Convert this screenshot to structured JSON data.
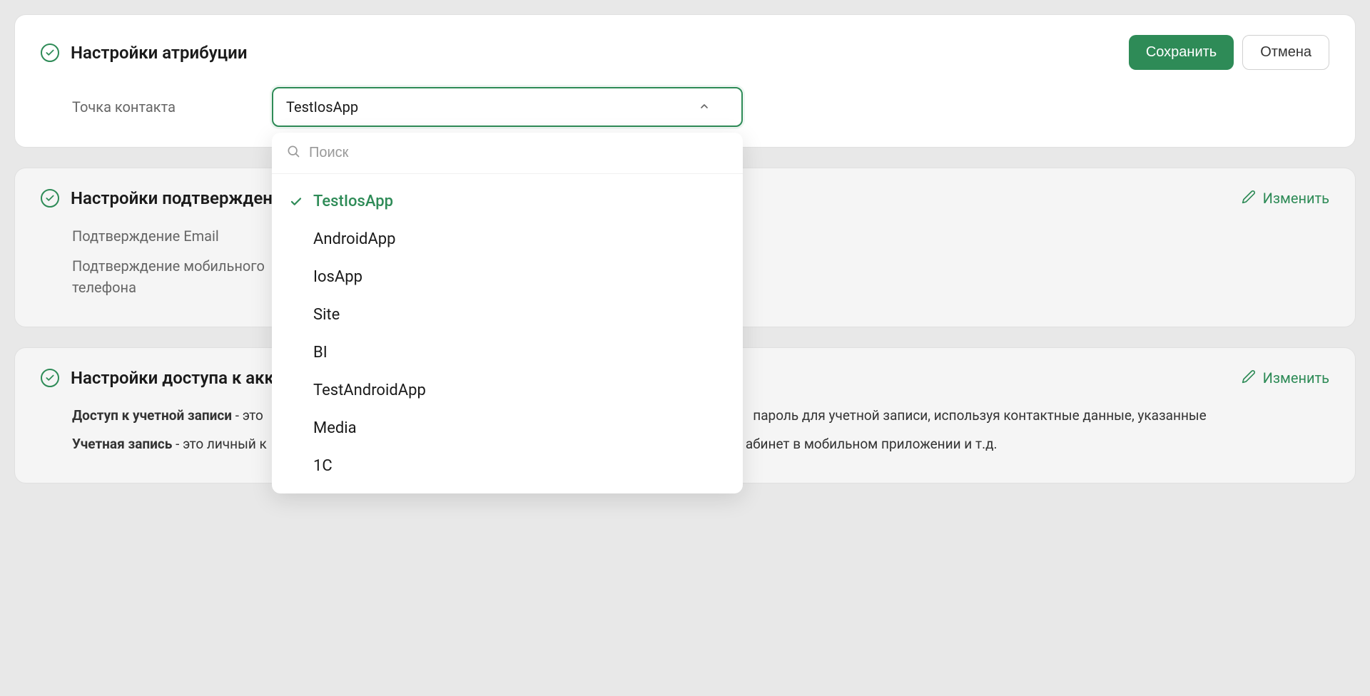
{
  "card1": {
    "title": "Настройки атрибуции",
    "save_label": "Сохранить",
    "cancel_label": "Отмена",
    "field_label": "Точка контакта",
    "selected_value": "TestIosApp",
    "search_placeholder": "Поиск",
    "options": [
      "TestIosApp",
      "AndroidApp",
      "IosApp",
      "Site",
      "BI",
      "TestAndroidApp",
      "Media",
      "1C"
    ],
    "selected_index": 0
  },
  "card2": {
    "title": "Настройки подтвержден",
    "edit_label": "Изменить",
    "rows": [
      "Подтверждение Email",
      "Подтверждение мобильного телефона"
    ]
  },
  "card3": {
    "title": "Настройки доступа к акк",
    "edit_label": "Изменить",
    "desc1_prefix": "Доступ к учетной записи",
    "desc1_rest": " - это",
    "desc1_tail": " пароль для учетной записи, используя контактные данные, указанные",
    "desc2_prefix": "Учетная запись",
    "desc2_rest": " - это личный к",
    "desc2_tail": "абинет в мобильном приложении и т.д."
  }
}
